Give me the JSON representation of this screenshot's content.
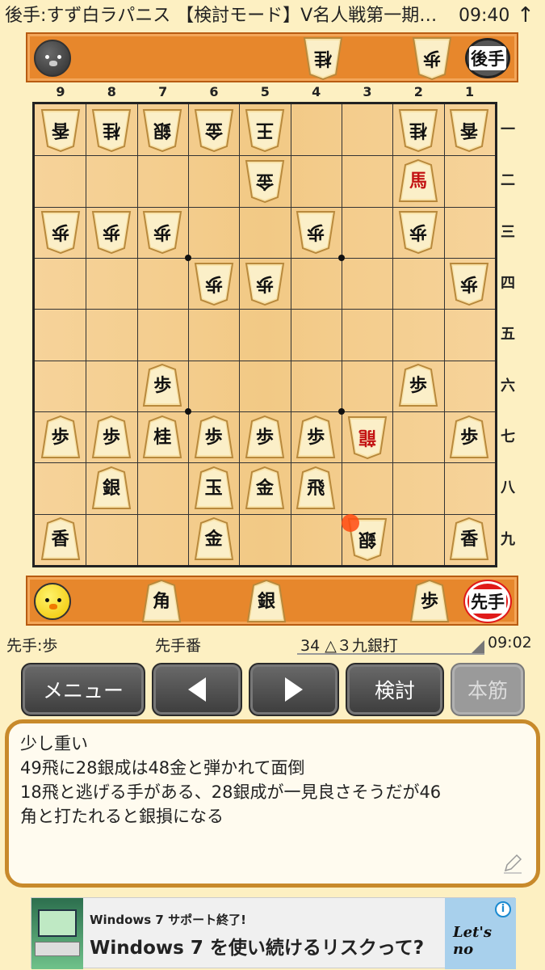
{
  "status_bar": {
    "title": "後手:すず白ラパニス 【検討モード】V名人戦第一期…",
    "time": "09:40",
    "arrow_icon": "up-arrow-icon"
  },
  "gote_hand": {
    "badge": "後手",
    "pieces": [
      "桂",
      "歩"
    ]
  },
  "sente_hand": {
    "badge": "先手",
    "pieces": [
      "角",
      "銀",
      "歩"
    ]
  },
  "file_labels": [
    "9",
    "8",
    "7",
    "6",
    "5",
    "4",
    "3",
    "2",
    "1"
  ],
  "rank_labels": [
    "一",
    "二",
    "三",
    "四",
    "五",
    "六",
    "七",
    "八",
    "九"
  ],
  "board": {
    "pieces": [
      {
        "file": 9,
        "rank": 1,
        "kanji": "香",
        "owner": "gote"
      },
      {
        "file": 8,
        "rank": 1,
        "kanji": "桂",
        "owner": "gote"
      },
      {
        "file": 7,
        "rank": 1,
        "kanji": "銀",
        "owner": "gote"
      },
      {
        "file": 6,
        "rank": 1,
        "kanji": "金",
        "owner": "gote"
      },
      {
        "file": 5,
        "rank": 1,
        "kanji": "王",
        "owner": "gote"
      },
      {
        "file": 2,
        "rank": 1,
        "kanji": "桂",
        "owner": "gote"
      },
      {
        "file": 1,
        "rank": 1,
        "kanji": "香",
        "owner": "gote"
      },
      {
        "file": 5,
        "rank": 2,
        "kanji": "金",
        "owner": "gote"
      },
      {
        "file": 2,
        "rank": 2,
        "kanji": "馬",
        "owner": "sente",
        "promoted": true
      },
      {
        "file": 9,
        "rank": 3,
        "kanji": "歩",
        "owner": "gote"
      },
      {
        "file": 8,
        "rank": 3,
        "kanji": "歩",
        "owner": "gote"
      },
      {
        "file": 7,
        "rank": 3,
        "kanji": "歩",
        "owner": "gote"
      },
      {
        "file": 4,
        "rank": 3,
        "kanji": "歩",
        "owner": "gote"
      },
      {
        "file": 2,
        "rank": 3,
        "kanji": "歩",
        "owner": "gote"
      },
      {
        "file": 6,
        "rank": 4,
        "kanji": "歩",
        "owner": "gote"
      },
      {
        "file": 5,
        "rank": 4,
        "kanji": "歩",
        "owner": "gote"
      },
      {
        "file": 1,
        "rank": 4,
        "kanji": "歩",
        "owner": "gote"
      },
      {
        "file": 7,
        "rank": 6,
        "kanji": "歩",
        "owner": "sente"
      },
      {
        "file": 2,
        "rank": 6,
        "kanji": "歩",
        "owner": "sente"
      },
      {
        "file": 9,
        "rank": 7,
        "kanji": "歩",
        "owner": "sente"
      },
      {
        "file": 8,
        "rank": 7,
        "kanji": "歩",
        "owner": "sente"
      },
      {
        "file": 7,
        "rank": 7,
        "kanji": "桂",
        "owner": "sente"
      },
      {
        "file": 6,
        "rank": 7,
        "kanji": "歩",
        "owner": "sente"
      },
      {
        "file": 5,
        "rank": 7,
        "kanji": "歩",
        "owner": "sente"
      },
      {
        "file": 4,
        "rank": 7,
        "kanji": "歩",
        "owner": "sente"
      },
      {
        "file": 3,
        "rank": 7,
        "kanji": "龍",
        "owner": "gote",
        "promoted": true
      },
      {
        "file": 1,
        "rank": 7,
        "kanji": "歩",
        "owner": "sente"
      },
      {
        "file": 8,
        "rank": 8,
        "kanji": "銀",
        "owner": "sente"
      },
      {
        "file": 6,
        "rank": 8,
        "kanji": "玉",
        "owner": "sente"
      },
      {
        "file": 5,
        "rank": 8,
        "kanji": "金",
        "owner": "sente"
      },
      {
        "file": 4,
        "rank": 8,
        "kanji": "飛",
        "owner": "sente"
      },
      {
        "file": 9,
        "rank": 9,
        "kanji": "香",
        "owner": "sente"
      },
      {
        "file": 6,
        "rank": 9,
        "kanji": "金",
        "owner": "sente"
      },
      {
        "file": 3,
        "rank": 9,
        "kanji": "銀",
        "owner": "gote"
      },
      {
        "file": 1,
        "rank": 9,
        "kanji": "香",
        "owner": "sente"
      }
    ],
    "last_move": {
      "file": 3,
      "rank": 9
    }
  },
  "info": {
    "hand_text": "先手:歩",
    "turn_text": "先手番",
    "move_text": "34 △３九銀打",
    "clock": "09:02"
  },
  "buttons": {
    "menu": "メニュー",
    "prev_icon": "triangle-left-icon",
    "next_icon": "triangle-right-icon",
    "analyze": "検討",
    "main_line": "本筋"
  },
  "comment": {
    "lines": [
      "少し重い",
      "49飛に28銀成は48金と弾かれて面倒",
      "18飛と逃げる手がある、28銀成が一見良さそうだが46",
      "角と打たれると銀損になる"
    ],
    "edit_icon": "pencil-icon"
  },
  "ad": {
    "small_text": "Windows 7 サポート終了!",
    "large_text": "Windows 7 を使い続けるリスクって?",
    "logo_text": "Let's no",
    "info_icon": "i"
  }
}
